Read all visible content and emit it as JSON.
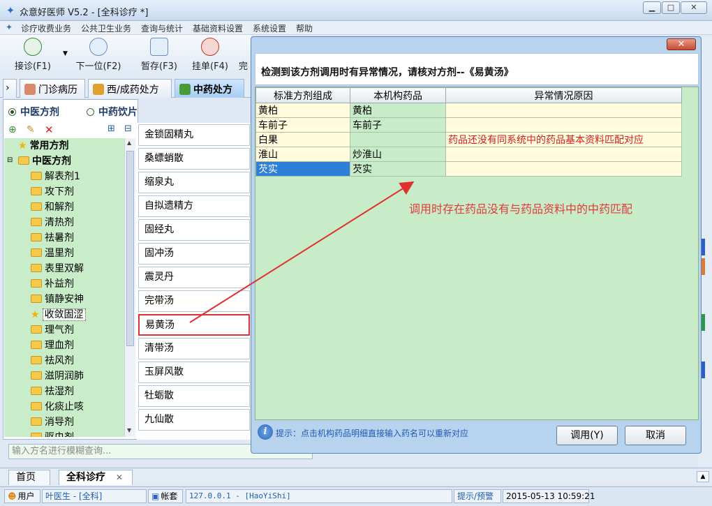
{
  "window": {
    "title": "众意好医师 V5.2 - [全科诊疗 *]",
    "min": "▁",
    "max": "□",
    "close": "✕"
  },
  "menu": [
    "诊疗收费业务",
    "公共卫生业务",
    "查询与统计",
    "基础资料设置",
    "系统设置",
    "帮助"
  ],
  "toolbar": [
    {
      "label": "接诊(F1)",
      "icon": "user-add-icon",
      "color": "#3a8a3a"
    },
    {
      "label": "下一位(F2)",
      "icon": "next-user-icon",
      "color": "#2d6fc0"
    },
    {
      "label": "暂存(F3)",
      "icon": "save-icon",
      "color": "#2d6fc0"
    },
    {
      "label": "挂单(F4)",
      "icon": "hand-icon",
      "color": "#c0392b"
    },
    {
      "label": "完"
    }
  ],
  "tabs": [
    {
      "label": "门诊病历",
      "color": "#a03a2a"
    },
    {
      "label": "西/成药处方",
      "color": "#3a78c8"
    },
    {
      "label": "中药处方",
      "color": "#4a9a3a"
    }
  ],
  "radios": [
    {
      "label": "中医方剂",
      "checked": true
    },
    {
      "label": "中药饮片",
      "checked": false
    }
  ],
  "tree": {
    "roots": [
      {
        "label": "常用方剂",
        "icon": "star"
      },
      {
        "label": "中医方剂",
        "icon": "folder"
      }
    ],
    "children": [
      "解表剂1",
      "攻下剂",
      "和解剂",
      "清热剂",
      "祛暑剂",
      "温里剂",
      "表里双解",
      "补益剂",
      "镇静安神",
      "收敛固涩",
      "理气剂",
      "理血剂",
      "祛风剂",
      "滋阴润肺",
      "祛湿剂",
      "化痰止咳",
      "消导剂",
      "驱虫剂"
    ],
    "selected": "收敛固涩"
  },
  "formulas": [
    "金锁固精丸",
    "桑螵蛸散",
    "缩泉丸",
    "自拟遗精方",
    "固经丸",
    "固冲汤",
    "震灵丹",
    "完带汤",
    "易黄汤",
    "清带汤",
    "玉屏风散",
    "牡蛎散",
    "九仙散"
  ],
  "highlighted_formula": "易黄汤",
  "search": {
    "placeholder": "输入方名进行模糊查询..."
  },
  "dialog": {
    "message": "检测到该方剂调用时有异常情况，请核对方剂--《易黄汤》",
    "columns": [
      "标准方剂组成",
      "本机构药品",
      "异常情况原因"
    ],
    "rows": [
      [
        "黄柏",
        "黄柏",
        ""
      ],
      [
        "车前子",
        "车前子",
        ""
      ],
      [
        "白果",
        "",
        "药品还没有同系统中的药品基本资料匹配对应"
      ],
      [
        "淮山",
        "炒淮山",
        ""
      ],
      [
        "芡实",
        "芡实",
        ""
      ]
    ],
    "selected_row": 4,
    "annotation": "调用时存在药品没有与药品资料中的中药匹配",
    "tip": "提示：点击机构药品明细直接输入药名可以重新对应",
    "ok_button": "调用(Y)",
    "cancel_button": "取消"
  },
  "bottom_tabs": [
    {
      "label": "首页"
    },
    {
      "label": "全科诊疗",
      "close": "✕"
    }
  ],
  "statusbar": {
    "user_label": "用户",
    "user": "叶医生 - [全科]",
    "account_label": "帐套",
    "server": "127.0.0.1 - [HaoYiShi]",
    "alert": "提示/预警",
    "datetime": "2015-05-13 10:59:21"
  },
  "colors": {
    "highlight_border": "#e03030",
    "annotation": "#e03b3b",
    "grid_bg": "#c8ecc8",
    "selected_row": "#2f7fd8"
  }
}
